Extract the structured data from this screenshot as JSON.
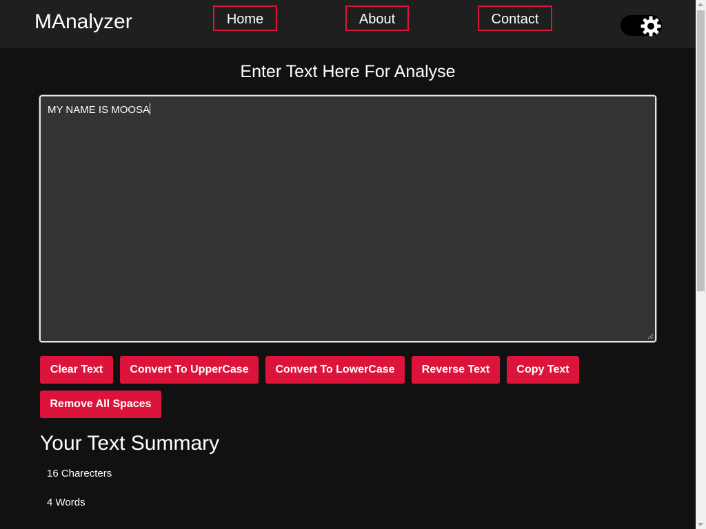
{
  "navbar": {
    "brand": "MAnalyzer",
    "links": [
      {
        "label": "Home"
      },
      {
        "label": "About"
      },
      {
        "label": "Contact"
      }
    ],
    "theme_toggle_icon": "gear-icon"
  },
  "main": {
    "heading": "Enter Text Here For Analyse",
    "textarea_value": "MY NAME IS MOOSA",
    "buttons": {
      "clear": "Clear Text",
      "upper": "Convert To UpperCase",
      "lower": "Convert To LowerCase",
      "reverse": "Reverse Text",
      "copy": "Copy Text",
      "remove_spaces": "Remove All Spaces"
    }
  },
  "summary": {
    "title": "Your Text Summary",
    "characters": "16 Charecters",
    "words": "4 Words"
  },
  "colors": {
    "accent": "#dc143c",
    "background": "#111112",
    "navbar": "#1f1f1f",
    "textarea": "#333333"
  }
}
